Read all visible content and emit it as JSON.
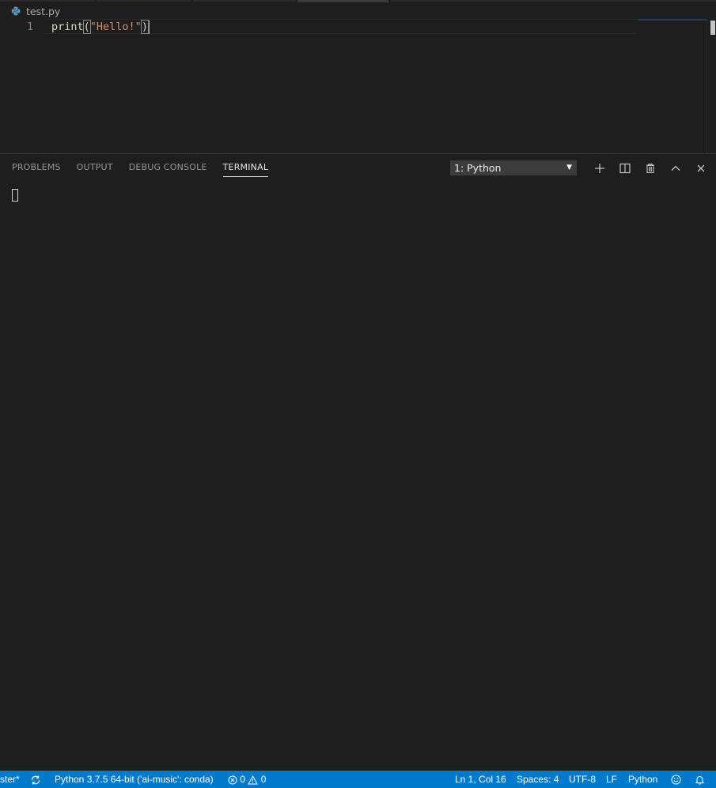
{
  "editor": {
    "breadcrumb_file": "test.py",
    "line_number": "1",
    "code": {
      "fn": "print",
      "open_paren": "(",
      "string": "\"Hello!\"",
      "close_paren": ")"
    }
  },
  "panel": {
    "tabs": [
      {
        "label": "PROBLEMS"
      },
      {
        "label": "OUTPUT"
      },
      {
        "label": "DEBUG CONSOLE"
      },
      {
        "label": "TERMINAL"
      }
    ],
    "active_tab": "TERMINAL",
    "terminal_select": "1: Python"
  },
  "statusbar": {
    "branch": "ster*",
    "interpreter": "Python 3.7.5 64-bit ('ai-music': conda)",
    "errors": "0",
    "warnings": "0",
    "position": "Ln 1, Col 16",
    "spaces": "Spaces: 4",
    "encoding": "UTF-8",
    "eol": "LF",
    "language": "Python"
  },
  "colors": {
    "statusbar_bg": "#007acc",
    "editor_bg": "#1e1e1e",
    "function": "#dcdcaa",
    "string": "#ce9178"
  }
}
